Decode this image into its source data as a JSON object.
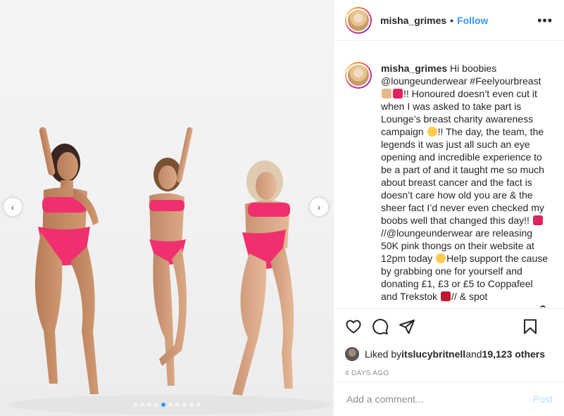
{
  "post": {
    "username": "misha_grimes",
    "separator": "•",
    "follow_label": "Follow",
    "more_label": "•••",
    "caption": {
      "username": "misha_grimes",
      "segments": [
        " Hi boobies @loungeunderwear #Feelyourbreast ",
        "!! Honoured doesn’t even cut it when I was asked to take part is Lounge’s breast charity awareness campaign ",
        "!! The day, the team, the legends it was just all such an eye opening and incredible experience to be a part of and it taught me so much about breast cancer and the fact is doesn’t care how old you are & the sheer fact I’d never even checked my boobs well that changed this day!! ",
        "//@loungeunderwear are releasing 50K pink thongs on their website at 12pm today ",
        "Help support the cause by grabbing one for yourself and donating £1, £3 or £5 to Coppafeel and Trekstok ",
        "// & spot"
      ]
    },
    "likes": {
      "prefix": "Liked by ",
      "user": "itslucybritnell",
      "middle": " and ",
      "others": "19,123 others"
    },
    "timestamp": "4 DAYS AGO",
    "comment": {
      "placeholder": "Add a comment...",
      "post_label": "Post"
    },
    "carousel": {
      "prev_label": "‹",
      "next_label": "›",
      "dot_count": 10,
      "active_index": 4
    }
  },
  "icons": {
    "like": "heart-icon",
    "comment": "comment-icon",
    "share": "share-icon",
    "save": "bookmark-icon"
  },
  "colors": {
    "accent": "#3897f0",
    "post_button": "#b2dffc",
    "bikini": "#f0306e"
  }
}
